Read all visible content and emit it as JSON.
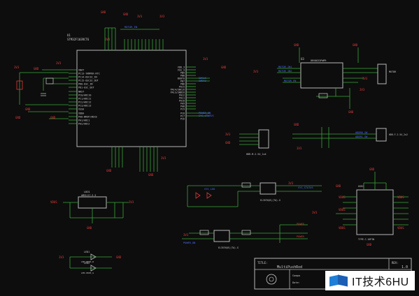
{
  "colors": {
    "background": "#0d0d0d",
    "wire": "#3aa53a",
    "power": "#e23a3a",
    "net_label": "#4a6cff",
    "outline": "#b8b8b8",
    "text": "#cfcfcf"
  },
  "title_block": {
    "title_label": "TITLE:",
    "title": "MultiPushRod",
    "rev_label": "REV:",
    "rev": "1.0",
    "field_a": "Compa",
    "field_b": "Date:"
  },
  "mcu": {
    "designator": "U1",
    "part": "STM32F103RCT6",
    "left_pins": [
      "VBAT",
      "PC13-TAMPER-RTC",
      "PC14-OSC32_IN",
      "PC15-OSC32_OUT",
      "PD0-OSC_IN",
      "PD1-OSC_OUT",
      "NRST",
      "PC0/ADC10",
      "PC1/ADC11",
      "PC2/ADC12",
      "PC3/ADC13",
      "VSSA",
      "VDDA",
      "PA0-WKUP/ADC0",
      "PA1/ADC1",
      "PA2/ADC2"
    ],
    "right_pins": [
      "VDD_3",
      "VSS_3",
      "PB9",
      "PB8",
      "BOOT0",
      "PB7",
      "PB6",
      "PA15",
      "PA14/SWCLK",
      "PA13/SWDIO",
      "PA12",
      "PA11",
      "PA10",
      "PA9",
      "PA8",
      "PC9",
      "PC8",
      "PC7",
      "PC6"
    ],
    "right_nets": [
      "SWCLK",
      "SWDIO",
      "POWER_ON",
      "SYS_STATUS"
    ],
    "top_nets": [
      "MOTOR_EN"
    ]
  },
  "power_labels": {
    "v33": "3V3",
    "gnd": "GND",
    "vbus": "VBUS"
  },
  "motor_driver": {
    "designator": "U3",
    "part": "DRV8833PWPR",
    "left_nets": [
      "MOTOR_IN1",
      "MOTOR_IN2",
      "MOTOR_EN"
    ],
    "connector": "MOTOR"
  },
  "swd_header": {
    "caption": "HDR-M-2.54_1x4"
  },
  "ldo": {
    "designator": "LDO1",
    "part": "AMS1117-3.3"
  },
  "leds": {
    "led1": "LED1",
    "led2": "LED2",
    "led1_part": "LED-0603_R",
    "led2_part": "LED-0603_G"
  },
  "optocouplers": {
    "oc1": "EL357N(B)(TA)-G",
    "oc2": "EL357N(B)(TA)-G",
    "oc1_net": "SYS_STATUS",
    "oc2_net": "POWER_ON",
    "oc_in_net": "SYS_LED",
    "power_out": "POWER"
  },
  "usb": {
    "designator": "USB1",
    "part": "TYPE-C-16PIN"
  },
  "addr_header": {
    "nets": [
      "ADDR0_SW",
      "ADDR1_SW"
    ],
    "caption": "HDR-F-2.54_2x2"
  },
  "watermark": "IT技术6HU"
}
